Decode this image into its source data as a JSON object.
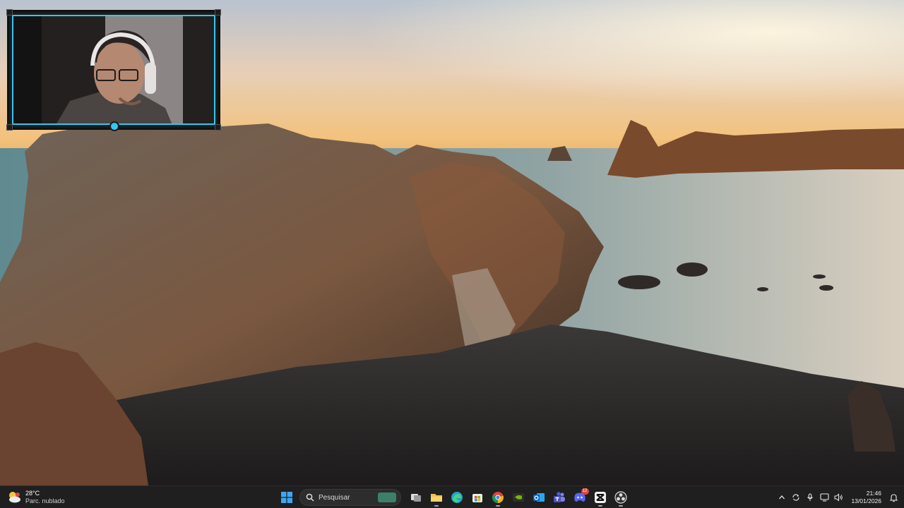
{
  "taskbar": {
    "weather": {
      "temperature": "28°C",
      "condition": "Parc. nublado"
    },
    "search": {
      "placeholder": "Pesquisar"
    },
    "pinned": [
      {
        "name": "task-view",
        "icon": "task-view-icon"
      },
      {
        "name": "file-explorer",
        "icon": "folder-icon"
      },
      {
        "name": "edge",
        "icon": "edge-icon"
      },
      {
        "name": "microsoft-store",
        "icon": "store-icon"
      },
      {
        "name": "chrome",
        "icon": "chrome-icon"
      },
      {
        "name": "nvidia",
        "icon": "nvidia-icon"
      },
      {
        "name": "outlook",
        "icon": "outlook-icon"
      },
      {
        "name": "teams",
        "icon": "teams-icon"
      },
      {
        "name": "discord",
        "icon": "discord-icon",
        "badge": "12"
      },
      {
        "name": "capcut",
        "icon": "capcut-icon"
      },
      {
        "name": "obs",
        "icon": "obs-icon"
      }
    ],
    "clock": {
      "time": "21:46",
      "date": "13/01/2026"
    }
  },
  "colors": {
    "accent": "#35c6f0",
    "taskbar": "#1f1f1f"
  }
}
